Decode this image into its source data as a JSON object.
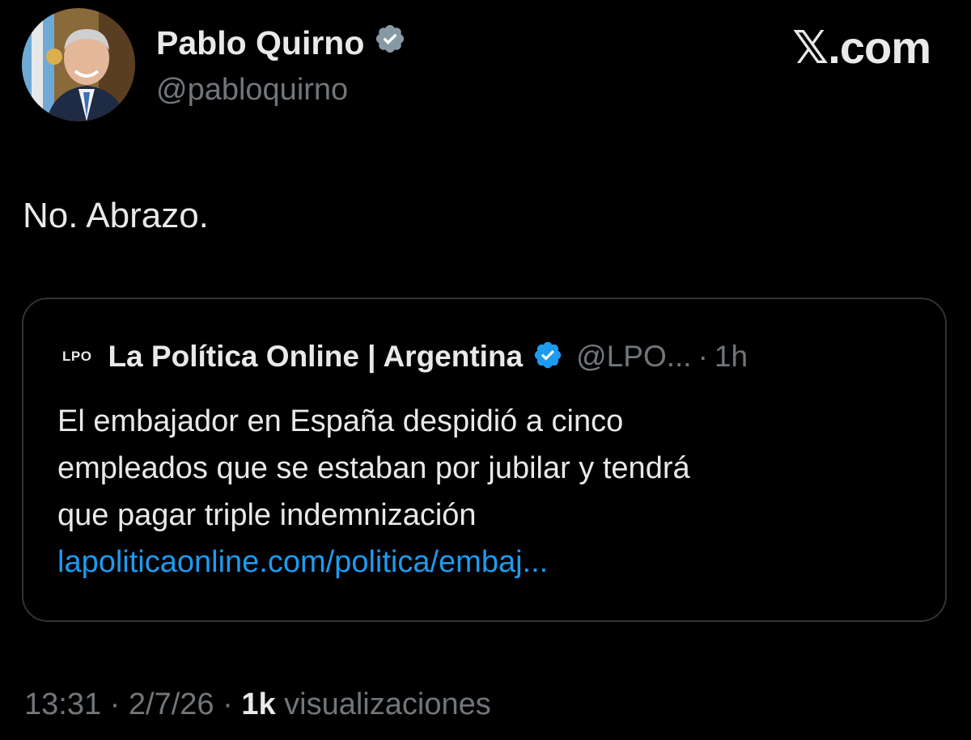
{
  "author": {
    "name": "Pablo Quirno",
    "handle": "@pabloquirno",
    "verified_icon": "verified-badge-icon"
  },
  "brand": {
    "label": "𝕏.com"
  },
  "tweet": {
    "text": "No. Abrazo."
  },
  "quote": {
    "logo_text": "LPO",
    "name": "La Política Online | Argentina",
    "handle": "@LPO...",
    "separator": "·",
    "time": "1h",
    "body_lines": [
      "El embajador en España despidió a cinco",
      "empleados que se estaban por jubilar y tendrá",
      "que pagar triple indemnización"
    ],
    "link": "lapoliticaonline.com/politica/embaj..."
  },
  "meta": {
    "time": "13:31",
    "sep1": "·",
    "date": "2/7/26",
    "sep2": "·",
    "views_count": "1k",
    "views_label": "visualizaciones"
  },
  "colors": {
    "background": "#000000",
    "text_primary": "#e7e9ea",
    "text_secondary": "#71767b",
    "link": "#1d9bf0",
    "verified": "#1d9bf0",
    "verified_author": "#8899a6",
    "border": "#2f3336"
  }
}
